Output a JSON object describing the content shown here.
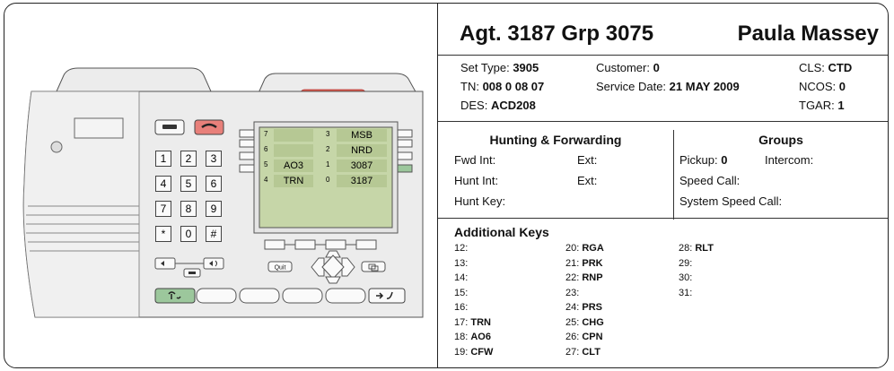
{
  "header": {
    "agent": "Agt. 3187 Grp 3075",
    "name": "Paula Massey"
  },
  "details": {
    "set_type_label": "Set Type:",
    "set_type": "3905",
    "customer_label": "Customer:",
    "customer": "0",
    "cls_label": "CLS:",
    "cls": "CTD",
    "tn_label": "TN:",
    "tn": "008 0 08 07",
    "service_date_label": "Service Date:",
    "service_date": "21 MAY 2009",
    "ncos_label": "NCOS:",
    "ncos": "0",
    "des_label": "DES:",
    "des": "ACD208",
    "tgar_label": "TGAR:",
    "tgar": "1"
  },
  "hunting": {
    "title": "Hunting & Forwarding",
    "fwd_int": "Fwd  Int:",
    "fwd_ext": "Ext:",
    "hunt_int": "Hunt Int:",
    "hunt_ext": "Ext:",
    "hunt_key": "Hunt Key:"
  },
  "groups": {
    "title": "Groups",
    "pickup_label": "Pickup:",
    "pickup": "0",
    "intercom": "Intercom:",
    "speed_call": "Speed Call:",
    "system_speed_call": "System Speed Call:"
  },
  "additional_keys": {
    "title": "Additional Keys",
    "col1": [
      {
        "num": "12:",
        "val": ""
      },
      {
        "num": "13:",
        "val": ""
      },
      {
        "num": "14:",
        "val": ""
      },
      {
        "num": "15:",
        "val": ""
      },
      {
        "num": "16:",
        "val": ""
      },
      {
        "num": "17:",
        "val": "TRN"
      },
      {
        "num": "18:",
        "val": "AO6"
      },
      {
        "num": "19:",
        "val": "CFW"
      }
    ],
    "col2": [
      {
        "num": "20:",
        "val": "RGA"
      },
      {
        "num": "21:",
        "val": "PRK"
      },
      {
        "num": "22:",
        "val": "RNP"
      },
      {
        "num": "23:",
        "val": ""
      },
      {
        "num": "24:",
        "val": "PRS"
      },
      {
        "num": "25:",
        "val": "CHG"
      },
      {
        "num": "26:",
        "val": "CPN"
      },
      {
        "num": "27:",
        "val": "CLT"
      }
    ],
    "col3": [
      {
        "num": "28:",
        "val": "RLT"
      },
      {
        "num": "29:",
        "val": ""
      },
      {
        "num": "30:",
        "val": ""
      },
      {
        "num": "31:",
        "val": ""
      }
    ]
  },
  "phone": {
    "lcd_left": [
      {
        "num": "7",
        "label": ""
      },
      {
        "num": "6",
        "label": ""
      },
      {
        "num": "5",
        "label": "AO3"
      },
      {
        "num": "4",
        "label": "TRN"
      }
    ],
    "lcd_right": [
      {
        "num": "3",
        "label": "MSB"
      },
      {
        "num": "2",
        "label": "NRD"
      },
      {
        "num": "1",
        "label": "3087"
      },
      {
        "num": "0",
        "label": "3187"
      }
    ],
    "keypad": [
      "1",
      "2",
      "3",
      "4",
      "5",
      "6",
      "7",
      "8",
      "9",
      "*",
      "0",
      "#"
    ],
    "quit_label": "Quit",
    "colors": {
      "lcd": "#c6d6a8",
      "red_button": "#e8807a",
      "green_button": "#9cc79c",
      "red_bar": "#e85a4a",
      "body": "#ececec"
    }
  }
}
